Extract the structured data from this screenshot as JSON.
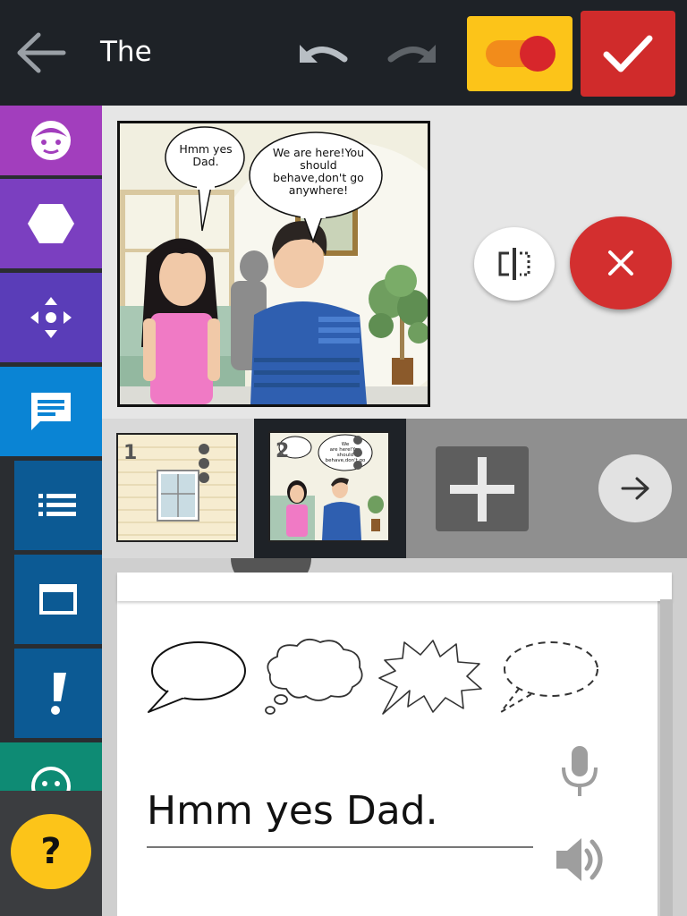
{
  "app": {
    "title": "The"
  },
  "topbar": {
    "back_icon": "arrow-left-icon",
    "undo_icon": "undo-icon",
    "redo_icon": "redo-icon",
    "toggle_icon": "toggle-switch-icon",
    "confirm_icon": "checkmark-icon",
    "colors": {
      "bar": "#1e2227",
      "toggle_bg": "#fcc419",
      "confirm_bg": "#d02b2b"
    }
  },
  "sidebar": {
    "tools": [
      {
        "name": "character-tool",
        "icon": "face-icon",
        "color": "#a23ebd"
      },
      {
        "name": "shape-tool",
        "icon": "hexagon-icon",
        "color": "#7b3fc0"
      },
      {
        "name": "move-tool",
        "icon": "move-arrows-icon",
        "color": "#5a3db8"
      },
      {
        "name": "speech-tool",
        "icon": "chat-bubble-icon",
        "color": "#0a84d4",
        "selected": true
      },
      {
        "name": "list-tool",
        "icon": "list-icon",
        "color": "#0c5a94"
      },
      {
        "name": "panel-tool",
        "icon": "window-icon",
        "color": "#0c5a94"
      },
      {
        "name": "emphasis-tool",
        "icon": "exclamation-icon",
        "color": "#0c5a94"
      },
      {
        "name": "emotion-tool",
        "icon": "smiley-icon",
        "color": "#0e8b74"
      }
    ],
    "help_label": "?"
  },
  "panel": {
    "bubble_1": "Hmm yes Dad.",
    "bubble_2": "We are here!You should behave,don't go anywhere!"
  },
  "preview_actions": {
    "flip_icon": "flip-horizontal-icon",
    "delete_icon": "close-icon"
  },
  "thumbnails": [
    {
      "number": "1",
      "selected": false
    },
    {
      "number": "2",
      "selected": true
    }
  ],
  "strip_actions": {
    "add_icon": "plus-icon",
    "next_icon": "arrow-right-icon"
  },
  "bubble_editor": {
    "bubble_types": [
      "speech-bubble-icon",
      "thought-bubble-icon",
      "shout-bubble-icon",
      "whisper-bubble-icon"
    ],
    "text_value": "Hmm yes Dad.",
    "mic_icon": "microphone-icon",
    "speaker_icon": "speaker-icon"
  }
}
